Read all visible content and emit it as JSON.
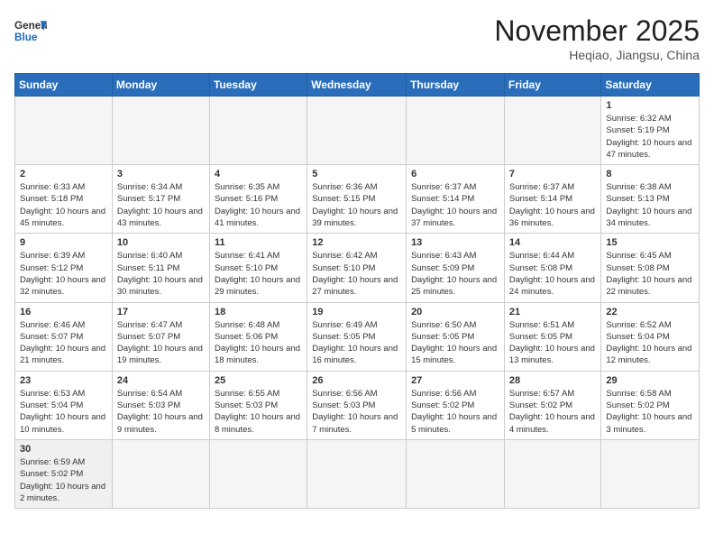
{
  "header": {
    "logo_general": "General",
    "logo_blue": "Blue",
    "month_title": "November 2025",
    "location": "Heqiao, Jiangsu, China"
  },
  "weekdays": [
    "Sunday",
    "Monday",
    "Tuesday",
    "Wednesday",
    "Thursday",
    "Friday",
    "Saturday"
  ],
  "weeks": [
    [
      {
        "day": "",
        "empty": true
      },
      {
        "day": "",
        "empty": true
      },
      {
        "day": "",
        "empty": true
      },
      {
        "day": "",
        "empty": true
      },
      {
        "day": "",
        "empty": true
      },
      {
        "day": "",
        "empty": true
      },
      {
        "day": "1",
        "rise": "6:32 AM",
        "set": "5:19 PM",
        "daylight": "10 hours and 47 minutes."
      }
    ],
    [
      {
        "day": "2",
        "rise": "6:33 AM",
        "set": "5:18 PM",
        "daylight": "10 hours and 45 minutes."
      },
      {
        "day": "3",
        "rise": "6:34 AM",
        "set": "5:17 PM",
        "daylight": "10 hours and 43 minutes."
      },
      {
        "day": "4",
        "rise": "6:35 AM",
        "set": "5:16 PM",
        "daylight": "10 hours and 41 minutes."
      },
      {
        "day": "5",
        "rise": "6:36 AM",
        "set": "5:15 PM",
        "daylight": "10 hours and 39 minutes."
      },
      {
        "day": "6",
        "rise": "6:37 AM",
        "set": "5:14 PM",
        "daylight": "10 hours and 37 minutes."
      },
      {
        "day": "7",
        "rise": "6:37 AM",
        "set": "5:14 PM",
        "daylight": "10 hours and 36 minutes."
      },
      {
        "day": "8",
        "rise": "6:38 AM",
        "set": "5:13 PM",
        "daylight": "10 hours and 34 minutes."
      }
    ],
    [
      {
        "day": "9",
        "rise": "6:39 AM",
        "set": "5:12 PM",
        "daylight": "10 hours and 32 minutes."
      },
      {
        "day": "10",
        "rise": "6:40 AM",
        "set": "5:11 PM",
        "daylight": "10 hours and 30 minutes."
      },
      {
        "day": "11",
        "rise": "6:41 AM",
        "set": "5:10 PM",
        "daylight": "10 hours and 29 minutes."
      },
      {
        "day": "12",
        "rise": "6:42 AM",
        "set": "5:10 PM",
        "daylight": "10 hours and 27 minutes."
      },
      {
        "day": "13",
        "rise": "6:43 AM",
        "set": "5:09 PM",
        "daylight": "10 hours and 25 minutes."
      },
      {
        "day": "14",
        "rise": "6:44 AM",
        "set": "5:08 PM",
        "daylight": "10 hours and 24 minutes."
      },
      {
        "day": "15",
        "rise": "6:45 AM",
        "set": "5:08 PM",
        "daylight": "10 hours and 22 minutes."
      }
    ],
    [
      {
        "day": "16",
        "rise": "6:46 AM",
        "set": "5:07 PM",
        "daylight": "10 hours and 21 minutes."
      },
      {
        "day": "17",
        "rise": "6:47 AM",
        "set": "5:07 PM",
        "daylight": "10 hours and 19 minutes."
      },
      {
        "day": "18",
        "rise": "6:48 AM",
        "set": "5:06 PM",
        "daylight": "10 hours and 18 minutes."
      },
      {
        "day": "19",
        "rise": "6:49 AM",
        "set": "5:05 PM",
        "daylight": "10 hours and 16 minutes."
      },
      {
        "day": "20",
        "rise": "6:50 AM",
        "set": "5:05 PM",
        "daylight": "10 hours and 15 minutes."
      },
      {
        "day": "21",
        "rise": "6:51 AM",
        "set": "5:05 PM",
        "daylight": "10 hours and 13 minutes."
      },
      {
        "day": "22",
        "rise": "6:52 AM",
        "set": "5:04 PM",
        "daylight": "10 hours and 12 minutes."
      }
    ],
    [
      {
        "day": "23",
        "rise": "6:53 AM",
        "set": "5:04 PM",
        "daylight": "10 hours and 10 minutes."
      },
      {
        "day": "24",
        "rise": "6:54 AM",
        "set": "5:03 PM",
        "daylight": "10 hours and 9 minutes."
      },
      {
        "day": "25",
        "rise": "6:55 AM",
        "set": "5:03 PM",
        "daylight": "10 hours and 8 minutes."
      },
      {
        "day": "26",
        "rise": "6:56 AM",
        "set": "5:03 PM",
        "daylight": "10 hours and 7 minutes."
      },
      {
        "day": "27",
        "rise": "6:56 AM",
        "set": "5:02 PM",
        "daylight": "10 hours and 5 minutes."
      },
      {
        "day": "28",
        "rise": "6:57 AM",
        "set": "5:02 PM",
        "daylight": "10 hours and 4 minutes."
      },
      {
        "day": "29",
        "rise": "6:58 AM",
        "set": "5:02 PM",
        "daylight": "10 hours and 3 minutes."
      }
    ],
    [
      {
        "day": "30",
        "rise": "6:59 AM",
        "set": "5:02 PM",
        "daylight": "10 hours and 2 minutes."
      },
      {
        "day": "",
        "empty": true
      },
      {
        "day": "",
        "empty": true
      },
      {
        "day": "",
        "empty": true
      },
      {
        "day": "",
        "empty": true
      },
      {
        "day": "",
        "empty": true
      },
      {
        "day": "",
        "empty": true
      }
    ]
  ]
}
